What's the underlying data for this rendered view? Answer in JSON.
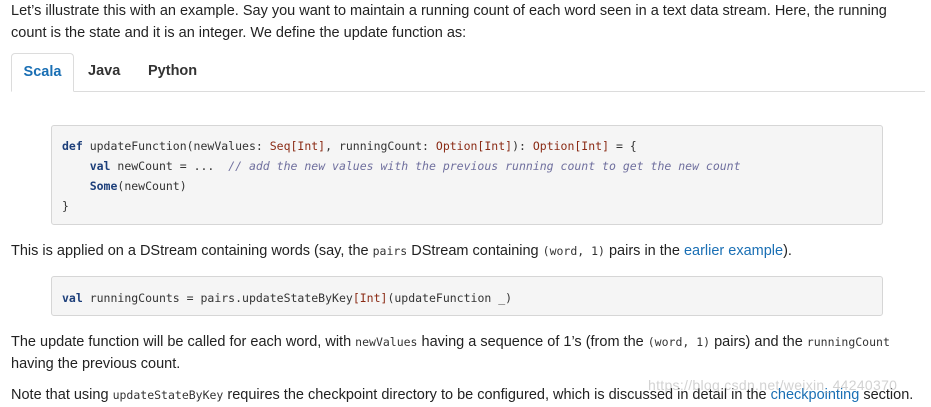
{
  "intro": {
    "text": "Let’s illustrate this with an example. Say you want to maintain a running count of each word seen in a text data stream. Here, the running count is the state and it is an integer. We define the update function as:"
  },
  "tabs": [
    "Scala",
    "Java",
    "Python"
  ],
  "active_tab": "Scala",
  "code1": {
    "line1": {
      "kw_def": "def",
      "sig": " updateFunction(newValues: ",
      "t1": "Seq[Int]",
      "mid": ", runningCount: ",
      "t2": "Option[Int]",
      "colon": "): ",
      "t3": "Option[Int]",
      "eq": " = {"
    },
    "line2": {
      "indent": "    ",
      "kw_val": "val",
      "rest": " newCount = ...  ",
      "comment": "// add the new values with the previous running count to get the new count"
    },
    "line3": {
      "indent": "    ",
      "kw_some": "Some",
      "rest": "(newCount)"
    },
    "line4": "}"
  },
  "para2": {
    "t1": "This is applied on a DStream containing words (say, the ",
    "c1": "pairs",
    "t2": " DStream containing ",
    "c2": "(word, 1)",
    "t3": " pairs in the ",
    "link": "earlier example",
    "t4": ")."
  },
  "code2": {
    "kw_val": "val",
    "rest1": " runningCounts = pairs.updateStateByKey",
    "type": "[Int]",
    "rest2": "(updateFunction _)"
  },
  "para3": {
    "t1": "The update function will be called for each word, with ",
    "c1": "newValues",
    "t2": " having a sequence of 1’s (from the ",
    "c2": "(word, 1)",
    "t3": " pairs) and the ",
    "c3": "runningCount",
    "t4": " having the previous count."
  },
  "para4": {
    "t1": "Note that using ",
    "c1": "updateStateByKey",
    "t2": " requires the checkpoint directory to be configured, which is discussed in detail in the ",
    "link": "checkpointing",
    "t3": " section."
  },
  "watermark": "https://blog.csdn.net/weixin_44240370",
  "colors": {
    "link": "#1a6fb4",
    "keyword": "#1d3f7a",
    "type": "#8a2a14",
    "comment": "#6f6f9e",
    "code_bg": "#f5f5f5"
  }
}
